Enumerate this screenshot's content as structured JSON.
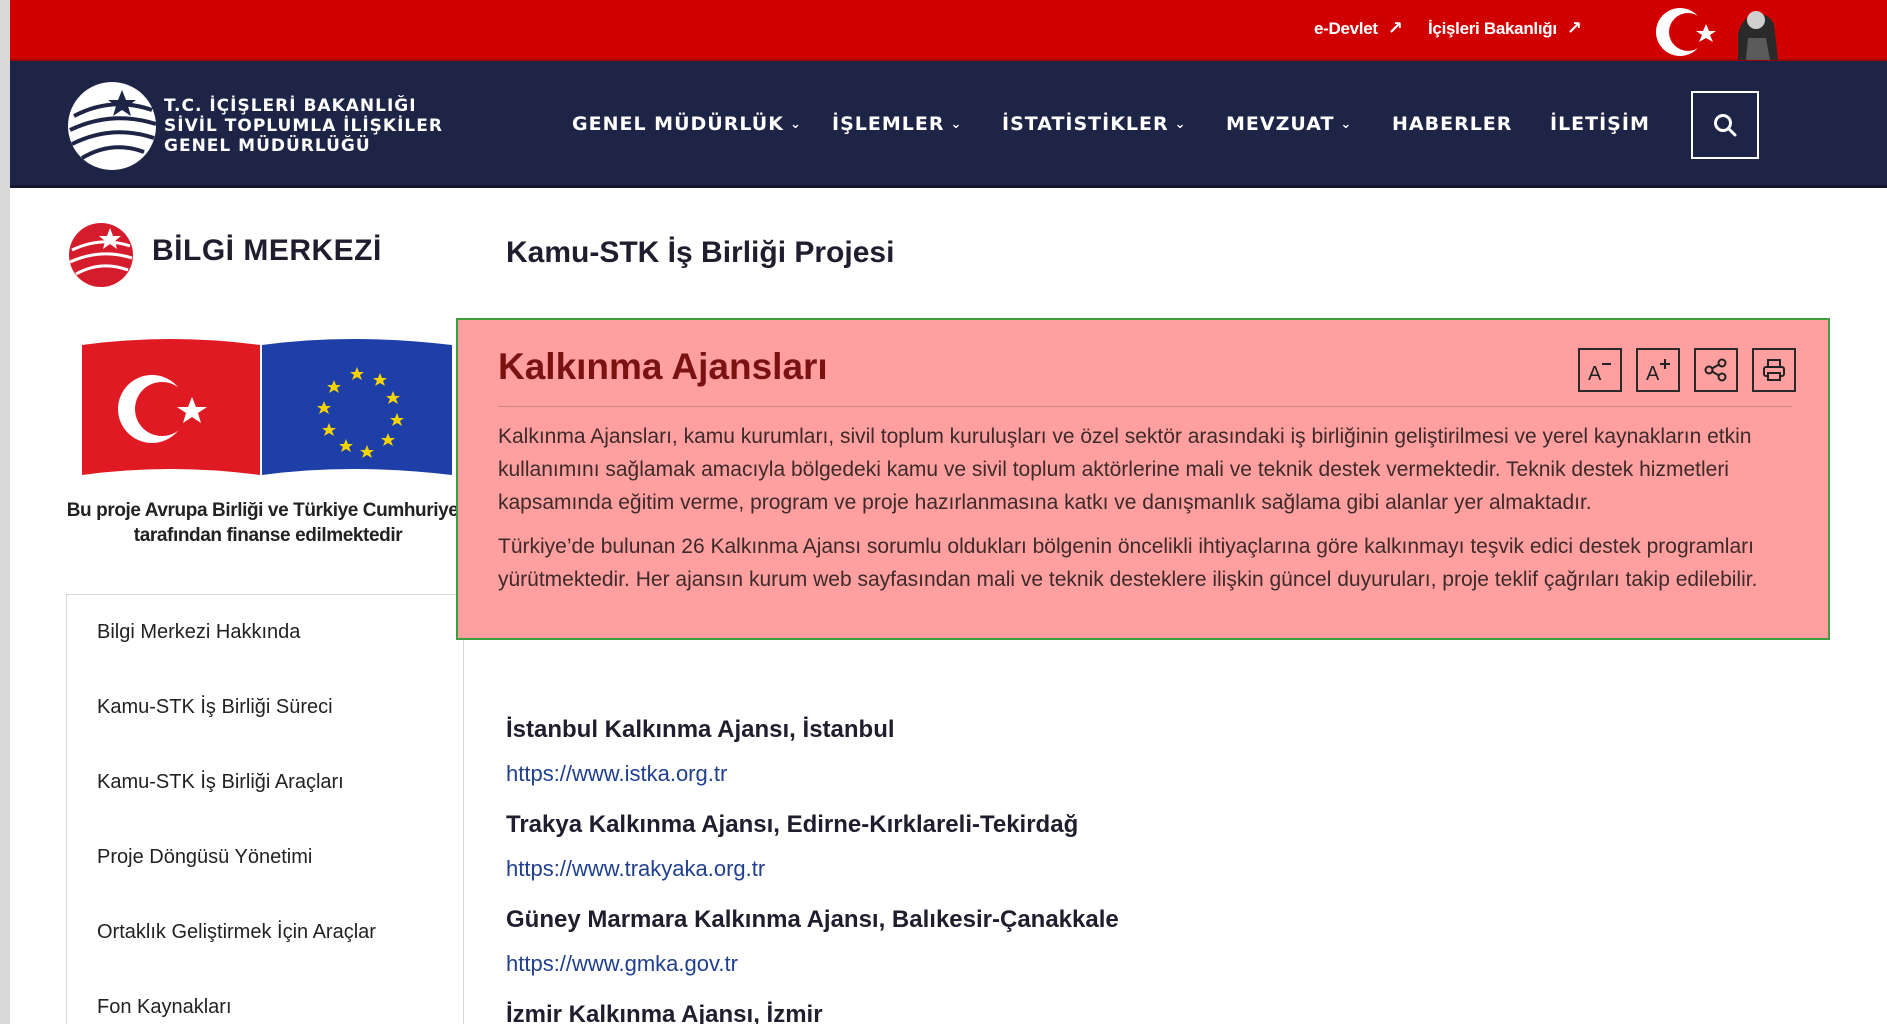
{
  "topbar": {
    "links": [
      {
        "label": "e-Devlet",
        "arrow": "↗"
      },
      {
        "label": "İçişleri Bakanlığı",
        "arrow": "↗"
      }
    ]
  },
  "logo": {
    "line1": "T.C. İÇİŞLERİ BAKANLIĞI",
    "line2": "SİVİL TOPLUMLA İLİŞKİLER",
    "line3": "GENEL MÜDÜRLÜĞÜ"
  },
  "nav": {
    "items": [
      {
        "label": "GENEL MÜDÜRLÜK",
        "chevron": "⌄"
      },
      {
        "label": "İŞLEMLER",
        "chevron": "⌄"
      },
      {
        "label": "İSTATİSTİKLER",
        "chevron": "⌄"
      },
      {
        "label": "MEVZUAT",
        "chevron": "⌄"
      },
      {
        "label": "HABERLER"
      },
      {
        "label": "İLETİŞİM"
      }
    ],
    "search_icon": "search-icon"
  },
  "sidebar": {
    "title": "BİLGİ MERKEZİ",
    "funding_line1": "Bu proje Avrupa Birliği ve Türkiye Cumhuriyeti",
    "funding_line2": "tarafından finanse edilmektedir",
    "items": [
      {
        "label": "Bilgi Merkezi Hakkında"
      },
      {
        "label": "Kamu-STK İş Birliği Süreci"
      },
      {
        "label": "Kamu-STK İş Birliği Araçları"
      },
      {
        "label": "Proje Döngüsü Yönetimi"
      },
      {
        "label": "Ortaklık Geliştirmek İçin Araçlar"
      },
      {
        "label": "Fon Kaynakları"
      }
    ]
  },
  "main": {
    "page_title": "Kamu-STK İş Birliği Projesi",
    "section_title": "Kalkınma Ajansları",
    "tools": {
      "decrease": "A",
      "increase": "A"
    },
    "paragraphs": [
      "Kalkınma Ajansları, kamu kurumları, sivil toplum kuruluşları ve özel sektör arasındaki iş birliğinin geliştirilmesi ve yerel kaynakların etkin kullanımını sağlamak amacıyla bölgedeki kamu ve sivil toplum aktörlerine mali ve teknik destek vermektedir. Teknik destek hizmetleri  kapsamında eğitim verme, program ve proje hazırlanmasına katkı ve danışmanlık sağlama gibi alanlar yer almaktadır.",
      "Türkiye’de bulunan 26 Kalkınma Ajansı sorumlu oldukları bölgenin öncelikli ihtiyaçlarına göre kalkınmayı teşvik edici destek programları yürütmektedir. Her ajansın kurum web sayfasından  mali ve teknik desteklere ilişkin güncel duyuruları, proje teklif çağrıları takip edilebilir."
    ],
    "agencies": [
      {
        "title": "İstanbul Kalkınma Ajansı, İstanbul",
        "url": "https://www.istka.org.tr"
      },
      {
        "title": "Trakya Kalkınma Ajansı, Edirne-Kırklareli-Tekirdağ",
        "url": "https://www.trakyaka.org.tr"
      },
      {
        "title": "Güney Marmara Kalkınma Ajansı, Balıkesir-Çanakkale",
        "url": "https://www.gmka.gov.tr"
      },
      {
        "title": "İzmir Kalkınma Ajansı, İzmir"
      }
    ]
  },
  "colors": {
    "topbar": "#d00000",
    "nav": "#1e2446",
    "highlight": "#ff9f9f",
    "highlight_border": "#3f9f3f",
    "section_title": "#7a1212",
    "link": "#1f3f8f"
  }
}
